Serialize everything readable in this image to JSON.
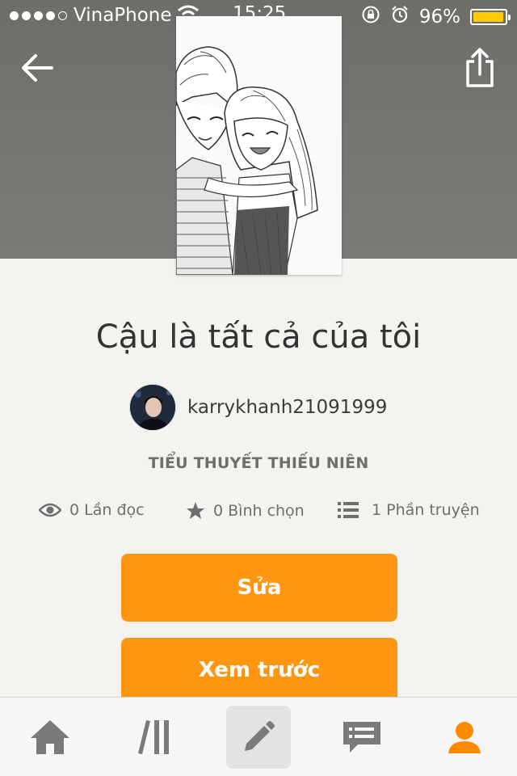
{
  "status_bar": {
    "carrier": "VinaPhone",
    "time": "15:25",
    "battery_percent": "96%",
    "battery_level": 0.96,
    "battery_color": "#ffcc00",
    "signal_dots_filled": 4,
    "icons": [
      "wifi-icon",
      "rotation-lock-icon",
      "alarm-icon"
    ]
  },
  "header": {
    "back_icon": "arrow-left-icon",
    "share_icon": "share-icon"
  },
  "story": {
    "title": "Cậu là tất cả của tôi",
    "author": "karrykhanh21091999",
    "category": "TIỂU THUYẾT THIẾU NIÊN",
    "stats": {
      "reads": "0 Lần đọc",
      "votes": "0 Bình chọn",
      "parts": "1 Phần truyện"
    }
  },
  "actions": {
    "edit_label": "Sửa",
    "preview_label": "Xem trước"
  },
  "tabbar": {
    "tabs": [
      {
        "icon": "home-icon"
      },
      {
        "icon": "library-icon"
      },
      {
        "icon": "pencil-icon",
        "active_bg": true
      },
      {
        "icon": "chat-icon"
      },
      {
        "icon": "user-icon",
        "selected": true
      }
    ]
  },
  "colors": {
    "accent": "#ff9612",
    "selected_tab": "#ff8a00",
    "tab_icon": "#7a7a7a",
    "header_bg": "#757370"
  }
}
